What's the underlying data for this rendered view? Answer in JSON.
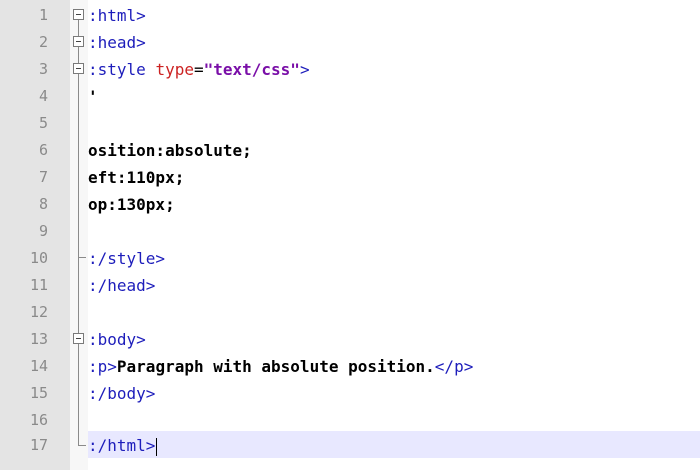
{
  "editor": {
    "line_numbers": [
      "1",
      "2",
      "3",
      "4",
      "5",
      "6",
      "7",
      "8",
      "9",
      "10",
      "11",
      "12",
      "13",
      "14",
      "15",
      "16",
      "17"
    ],
    "lines": {
      "l1": ":html>",
      "l2": ":head>",
      "l3_tag": ":style ",
      "l3_attr": "type",
      "l3_eq": "=",
      "l3_val": "\"text/css\"",
      "l3_end": ">",
      "l4": "'",
      "l6": "osition:absolute;",
      "l7": "eft:110px;",
      "l8": "op:130px;",
      "l10": ":/style>",
      "l11": ":/head>",
      "l13": ":body>",
      "l14_open": ":p>",
      "l14_text": "Paragraph with absolute position.",
      "l14_close": "</p>",
      "l15": ":/body>",
      "l17": ":/html>"
    },
    "colors": {
      "tag": "#1d1dbb",
      "attribute": "#cc2222",
      "attribute_value": "#7a0fa8",
      "current_line": "#e8e8ff",
      "gutter": "#e4e4e4"
    }
  }
}
